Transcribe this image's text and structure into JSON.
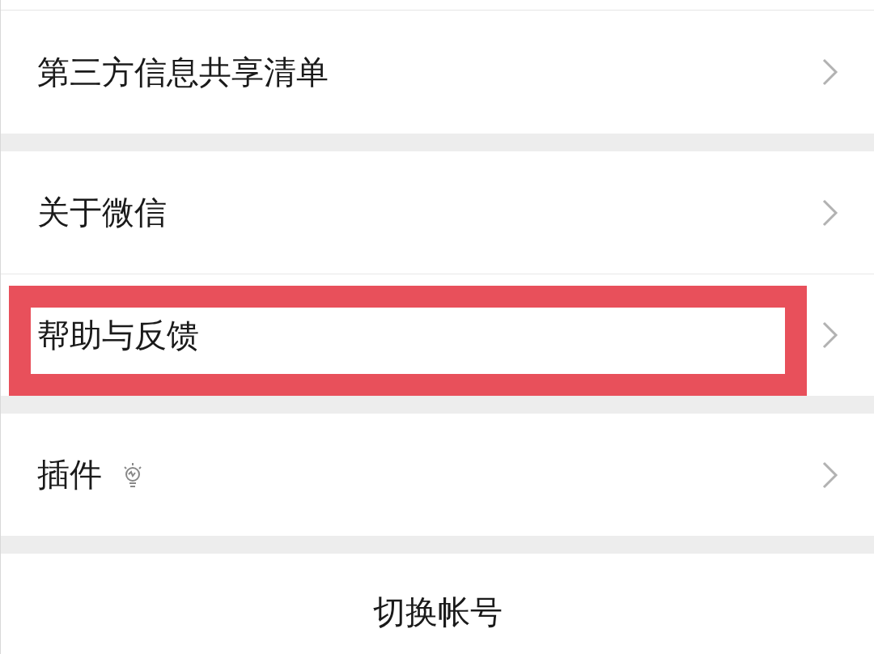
{
  "sections": [
    {
      "items": [
        {
          "label": "第三方信息共享清单",
          "kind": "link",
          "highlighted": false
        }
      ]
    },
    {
      "items": [
        {
          "label": "关于微信",
          "kind": "link",
          "highlighted": false
        },
        {
          "label": "帮助与反馈",
          "kind": "link",
          "highlighted": true
        }
      ]
    },
    {
      "items": [
        {
          "label": "插件",
          "kind": "link-with-icon",
          "highlighted": false
        }
      ]
    }
  ],
  "action": {
    "label": "切换帐号"
  }
}
